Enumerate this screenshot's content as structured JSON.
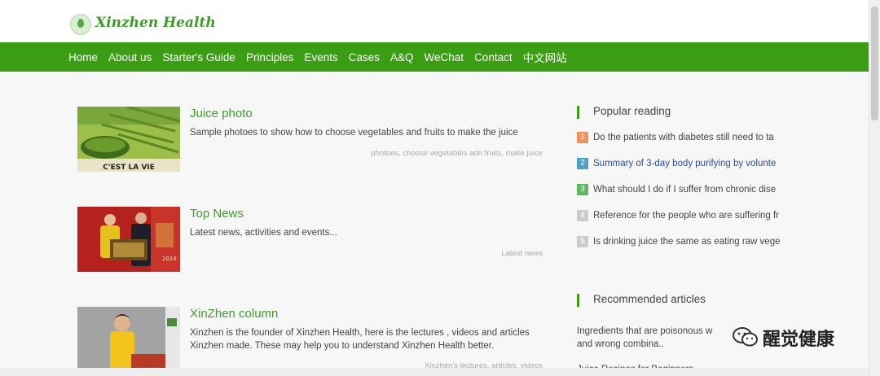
{
  "brand": {
    "name": "Xinzhen Health",
    "accent": "#3a9d12"
  },
  "nav": {
    "items": [
      "Home",
      "About us",
      "Starter's Guide",
      "Principles",
      "Events",
      "Cases",
      "A&Q",
      "WeChat",
      "Contact",
      "中文网站"
    ]
  },
  "articles": [
    {
      "title": "Juice photo",
      "desc": "Sample photoes to show how to choose vegetables and fruits to make the juice",
      "tags": "photoes, choose vegetables adn fruits, make juice",
      "thumb_caption": "C'EST LA VIE"
    },
    {
      "title": "Top News",
      "desc": "Latest news, activities and events...",
      "tags": "Latest news",
      "thumb_caption": "2018"
    },
    {
      "title": "XinZhen column",
      "desc": "Xinzhen is the founder of Xinzhen Health, here is the lectures , videos and articles Xinzhen made. These may help you to understand Xinzhen Health better.",
      "tags": "Xinzhen's lectures, articles, videos"
    }
  ],
  "sidebar": {
    "popular_title": "Popular reading",
    "popular": [
      {
        "num": "1",
        "text": "Do the patients with diabetes still need to ta",
        "color": "#f0935a",
        "text_color": "#444444"
      },
      {
        "num": "2",
        "text": "Summary of 3-day body purifying by volunte",
        "color": "#4aa3c7",
        "text_color": "#2d4c9a"
      },
      {
        "num": "3",
        "text": "What should I do if I suffer from chronic dise",
        "color": "#5bb860",
        "text_color": "#444444"
      },
      {
        "num": "4",
        "text": "Reference for the people who are suffering fr",
        "color": "#cccccc",
        "text_color": "#444444"
      },
      {
        "num": "5",
        "text": "Is drinking juice the same as eating raw vege",
        "color": "#cccccc",
        "text_color": "#444444"
      }
    ],
    "recommended_title": "Recommended articles",
    "recommended": [
      "Ingredients that are poisonous w",
      "and wrong combina..",
      "Juice Recipes for Beginners"
    ]
  },
  "watermark": {
    "text": "醒觉健康",
    "icon": "wechat-icon"
  }
}
